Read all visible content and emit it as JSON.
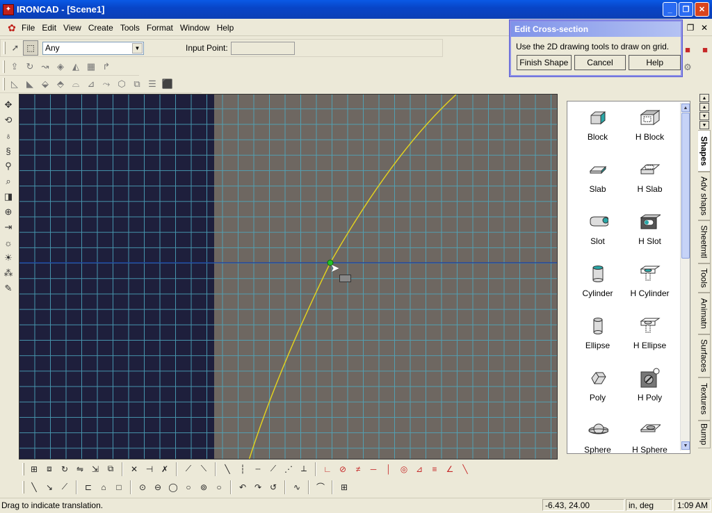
{
  "window": {
    "title": "IRONCAD - [Scene1]",
    "app_icon": "ironcad-logo-icon"
  },
  "menu": {
    "items": [
      "File",
      "Edit",
      "View",
      "Create",
      "Tools",
      "Format",
      "Window",
      "Help"
    ]
  },
  "selection_toolbar": {
    "filter_value": "Any",
    "input_point_label": "Input Point:",
    "input_point_value": ""
  },
  "dialog": {
    "title": "Edit Cross-section",
    "message": "Use the 2D drawing tools to draw on grid.",
    "buttons": [
      "Finish Shape",
      "Cancel",
      "Help"
    ]
  },
  "catalog": {
    "items": [
      "Block",
      "H Block",
      "Slab",
      "H Slab",
      "Slot",
      "H Slot",
      "Cylinder",
      "H Cylinder",
      "Ellipse",
      "H Ellipse",
      "Poly",
      "H Poly",
      "Sphere",
      "H Sphere"
    ],
    "tabs": [
      "Shapes",
      "Adv shaps",
      "Sheetmtl",
      "Tools",
      "Animatn",
      "Surfaces",
      "Textures",
      "Bump"
    ],
    "active_tab": "Shapes"
  },
  "viewport": {
    "colors": {
      "dark": "#1e1f3c",
      "plane": "#6e6761",
      "grid": "#4ea9c0",
      "curve": "#e0d020",
      "point": "#27c227"
    }
  },
  "status": {
    "message": "Drag to indicate translation.",
    "coords": "-6.43, 24.00",
    "units": "in, deg",
    "time": "1:09 AM"
  }
}
